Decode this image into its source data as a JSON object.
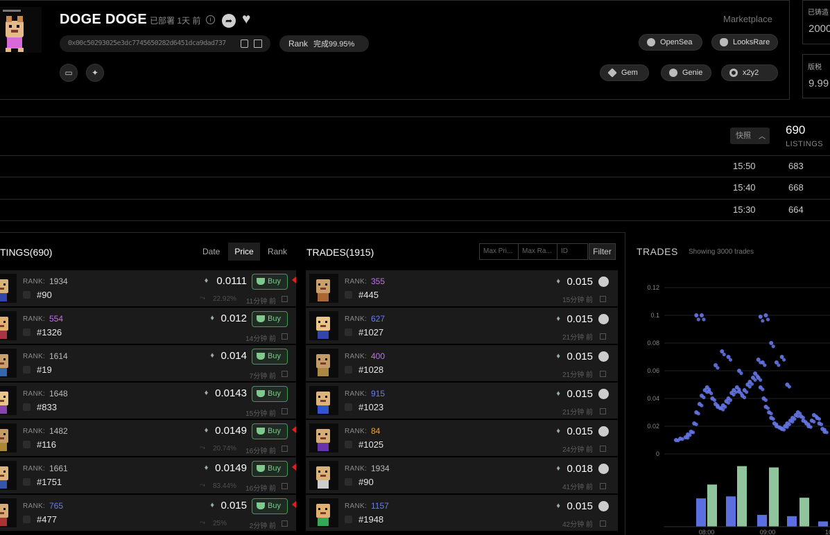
{
  "collection": {
    "name": "DOGE DOGE",
    "deployed": "已部署 1天 前",
    "address": "0x00c50293025e3dc7745650282d6451dca9dad737",
    "rank_label": "Rank",
    "rank_status": "完成99.95%"
  },
  "marketplace": {
    "label": "Marketplace",
    "buttons": [
      "OpenSea",
      "LooksRare",
      "Gem",
      "Genie",
      "x2y2"
    ]
  },
  "stats": [
    {
      "label": "已铸造",
      "value": "2000"
    },
    {
      "label": "版税",
      "value": "9.99"
    }
  ],
  "snapshot": {
    "button_label": "快照",
    "total": "690",
    "total_label": "LISTINGS",
    "rows": [
      {
        "time": "15:50",
        "count": "683"
      },
      {
        "time": "15:40",
        "count": "668"
      },
      {
        "time": "15:30",
        "count": "664"
      }
    ]
  },
  "listings": {
    "title": "TINGS(690)",
    "sort_tabs": [
      "Date",
      "Price",
      "Rank"
    ],
    "active_sort": "Price",
    "buy_label": "Buy",
    "rank_label": "RANK:",
    "items": [
      {
        "rank": "1934",
        "rank_color": "#bbbbbb",
        "token": "#90",
        "price": "0.0111",
        "change": "22.92%",
        "ago": "11分钟 前",
        "red": true
      },
      {
        "rank": "554",
        "rank_color": "#c070f0",
        "token": "#1326",
        "price": "0.012",
        "change": "",
        "ago": "14分钟 前",
        "red": false
      },
      {
        "rank": "1614",
        "rank_color": "#bbbbbb",
        "token": "#19",
        "price": "0.014",
        "change": "",
        "ago": "7分钟 前",
        "red": false
      },
      {
        "rank": "1648",
        "rank_color": "#bbbbbb",
        "token": "#833",
        "price": "0.0143",
        "change": "",
        "ago": "15分钟 前",
        "red": false
      },
      {
        "rank": "1482",
        "rank_color": "#bbbbbb",
        "token": "#116",
        "price": "0.0149",
        "change": "20.74%",
        "ago": "16分钟 前",
        "red": true
      },
      {
        "rank": "1661",
        "rank_color": "#bbbbbb",
        "token": "#1751",
        "price": "0.0149",
        "change": "83.44%",
        "ago": "16分钟 前",
        "red": true
      },
      {
        "rank": "765",
        "rank_color": "#6c7cf0",
        "token": "#477",
        "price": "0.015",
        "change": "25%",
        "ago": "2分钟 前",
        "red": true
      }
    ]
  },
  "trades": {
    "title": "TRADES(1915)",
    "filters": [
      "Max Pri...",
      "Max Ra...",
      "ID"
    ],
    "filter_button": "Filter",
    "rank_label": "RANK:",
    "items": [
      {
        "rank": "355",
        "rank_color": "#c070f0",
        "token": "#445",
        "price": "0.015",
        "ago": "15分钟 前"
      },
      {
        "rank": "627",
        "rank_color": "#6c7cf0",
        "token": "#1027",
        "price": "0.015",
        "ago": "21分钟 前"
      },
      {
        "rank": "400",
        "rank_color": "#c070f0",
        "token": "#1028",
        "price": "0.015",
        "ago": "21分钟 前"
      },
      {
        "rank": "915",
        "rank_color": "#6c7cf0",
        "token": "#1023",
        "price": "0.015",
        "ago": "21分钟 前"
      },
      {
        "rank": "84",
        "rank_color": "#f0a030",
        "token": "#1025",
        "price": "0.015",
        "ago": "24分钟 前"
      },
      {
        "rank": "1934",
        "rank_color": "#bbbbbb",
        "token": "#90",
        "price": "0.018",
        "ago": "41分钟 前"
      },
      {
        "rank": "1157",
        "rank_color": "#6c7cf0",
        "token": "#1948",
        "price": "0.015",
        "ago": "42分钟 前"
      }
    ]
  },
  "chart_data": {
    "type": "scatter",
    "title": "TRADES",
    "subtitle": "Showing 3000 trades",
    "xlabel": "",
    "ylabel": "",
    "ylim": [
      0,
      0.12
    ],
    "y_ticks": [
      "0.12",
      "0.1",
      "0.08",
      "0.06",
      "0.04",
      "0.02",
      "0"
    ],
    "x_ticks": [
      "08:00",
      "09:00",
      "10"
    ],
    "grid": true,
    "scatter_color": "#6678e8",
    "bar_colors": [
      "#5b6fe0",
      "#8fc49c"
    ],
    "series": [
      {
        "name": "",
        "x": [
          "07:41",
          "07:45",
          "07:50",
          "07:52",
          "07:55",
          "07:58",
          "08:00",
          "08:03",
          "08:05",
          "08:08",
          "08:10",
          "08:12",
          "08:15",
          "08:18",
          "08:20",
          "08:23",
          "08:25",
          "08:28",
          "08:30",
          "08:33",
          "08:35",
          "08:38",
          "08:40",
          "08:43",
          "08:45",
          "08:48",
          "08:50",
          "08:53",
          "08:55",
          "08:58",
          "09:00",
          "09:03",
          "09:05",
          "09:08",
          "09:10",
          "09:13",
          "09:15",
          "09:18",
          "09:20",
          "09:23",
          "09:25",
          "09:28",
          "09:30",
          "09:33",
          "09:35",
          "09:38",
          "09:40",
          "09:43",
          "09:45",
          "09:48",
          "09:50",
          "09:53",
          "09:55",
          "09:58",
          "10:00",
          "08:00",
          "08:05",
          "09:00",
          "09:05",
          "08:24",
          "08:30",
          "08:58",
          "09:02",
          "08:40",
          "09:10",
          "09:20",
          "09:15",
          "08:18",
          "09:25"
        ],
        "y": [
          0.01,
          0.011,
          0.012,
          0.014,
          0.016,
          0.022,
          0.03,
          0.036,
          0.042,
          0.046,
          0.048,
          0.045,
          0.04,
          0.036,
          0.034,
          0.033,
          0.035,
          0.038,
          0.04,
          0.044,
          0.046,
          0.048,
          0.045,
          0.042,
          0.046,
          0.05,
          0.052,
          0.055,
          0.058,
          0.055,
          0.048,
          0.04,
          0.034,
          0.03,
          0.026,
          0.022,
          0.02,
          0.019,
          0.018,
          0.02,
          0.022,
          0.024,
          0.026,
          0.028,
          0.03,
          0.027,
          0.024,
          0.022,
          0.02,
          0.024,
          0.028,
          0.026,
          0.022,
          0.018,
          0.016,
          0.1,
          0.1,
          0.099,
          0.1,
          0.074,
          0.07,
          0.068,
          0.066,
          0.06,
          0.08,
          0.07,
          0.066,
          0.064,
          0.05
        ]
      }
    ],
    "bar_series": [
      {
        "name": "",
        "values": [
          0.043,
          0.064,
          0.046,
          0.092,
          0.018,
          0.09,
          0.016,
          0.044,
          0.008
        ]
      }
    ]
  }
}
